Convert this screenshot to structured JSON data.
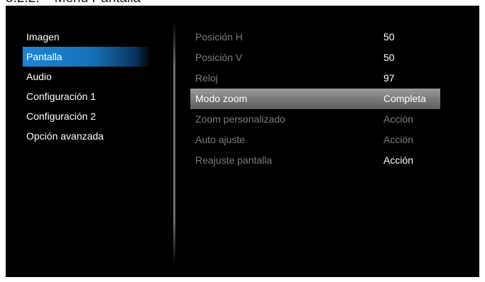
{
  "page_heading": "5.2.2.    Menú Pantalla",
  "sidebar": {
    "items": [
      {
        "label": "Imagen",
        "selected": false
      },
      {
        "label": "Pantalla",
        "selected": true
      },
      {
        "label": "Audio",
        "selected": false
      },
      {
        "label": "Configuración 1",
        "selected": false
      },
      {
        "label": "Configuración 2",
        "selected": false
      },
      {
        "label": "Opción avanzada",
        "selected": false
      }
    ]
  },
  "settings": {
    "rows": [
      {
        "label": "Posición H",
        "value": "50",
        "state": "disabled-label"
      },
      {
        "label": "Posición V",
        "value": "50",
        "state": "disabled-label"
      },
      {
        "label": "Reloj",
        "value": "97",
        "state": "disabled-label"
      },
      {
        "label": "Modo zoom",
        "value": "Completa",
        "state": "highlighted"
      },
      {
        "label": "Zoom personalizado",
        "value": "Acción",
        "state": "disabled"
      },
      {
        "label": "Auto ajuste",
        "value": "Acción",
        "state": "disabled"
      },
      {
        "label": "Reajuste pantalla",
        "value": "Acción",
        "state": "enabled"
      }
    ]
  },
  "colors": {
    "osd_background": "#000000",
    "selection_blue": "#1e86d6",
    "highlight_gray": "#8a8a8a",
    "disabled_text": "#7c7c7c"
  }
}
